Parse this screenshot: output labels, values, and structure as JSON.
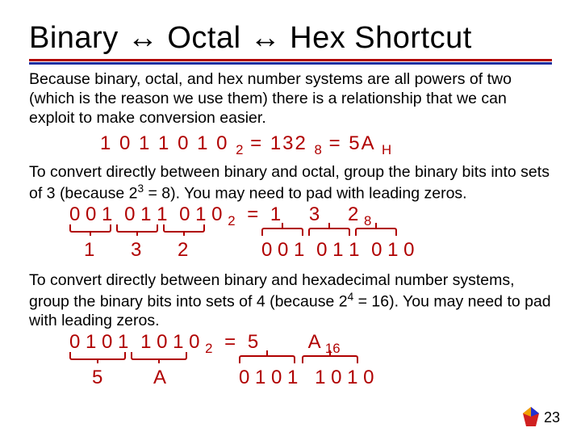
{
  "title": "Binary ↔ Octal ↔ Hex Shortcut",
  "para1": "Because binary, octal, and hex number systems are all powers of two (which is the reason we use them) there is a relationship that we can exploit to make conversion easier.",
  "eq_main": {
    "bits": "1 0 1 1 0 1 0",
    "sub1": "2",
    "eq1": "= 132",
    "sub2": "8",
    "eq2": "= 5A",
    "sub3": "H"
  },
  "para2a": "To convert directly between binary and octal, group the binary bits into sets of 3 (because 2",
  "para2exp": "3",
  "para2b": " = 8). You may need to pad with leading zeros.",
  "octal": {
    "padded_bits": [
      "0 0 1",
      "0 1 1",
      "0 1 0"
    ],
    "sub_in": "2",
    "eq": "=",
    "digits": [
      "1",
      "3",
      "2"
    ],
    "sub_out": "8",
    "under": [
      "1",
      "3",
      "2"
    ],
    "expand": [
      "0 0 1",
      "0 1 1",
      "0 1 0"
    ]
  },
  "para3a": "To convert directly between binary and hexadecimal number systems, group the binary bits into sets of 4 (because 2",
  "para3exp": "4",
  "para3b": " = 16). You may need to pad with leading zeros.",
  "hex": {
    "padded_bits": [
      "0 1 0 1",
      "1 0 1 0"
    ],
    "sub_in": "2",
    "eq": "=",
    "digits": [
      "5",
      "A"
    ],
    "sub_out": "16",
    "under": [
      "5",
      "A"
    ],
    "expand": [
      "0 1 0 1",
      "1 0 1 0"
    ]
  },
  "page_number": "23"
}
